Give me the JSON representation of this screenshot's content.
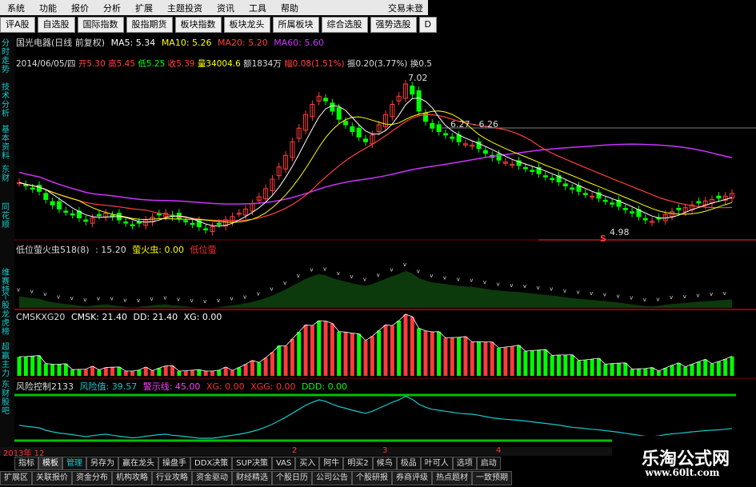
{
  "menu": {
    "items": [
      "系统",
      "功能",
      "报价",
      "分析",
      "扩展",
      "主题投资",
      "资讯",
      "工具",
      "帮助"
    ],
    "account": "交易未登"
  },
  "toolbar": [
    "评A股",
    "自选股",
    "国际指数",
    "股指期货",
    "板块指数",
    "板块龙头",
    "所属板块",
    "综合选股",
    "强势选股",
    "D"
  ],
  "leftnav": [
    "分时走势",
    "技术分析",
    "基本资料",
    "东财",
    "同花顺"
  ],
  "leftnav2": [
    "维赛特",
    "个股龙虎榜",
    "超赢主力",
    "东财股吧"
  ],
  "main": {
    "title_name": "国光电器(日线 前复权)",
    "ma5": "MA5: 5.34",
    "ma10": "MA10: 5.26",
    "ma20": "MA20: 5.20",
    "ma60": "MA60: 5.60",
    "date": "2014/06/05/四",
    "open": "开5.30",
    "high": "高5.45",
    "low": "低5.25",
    "close": "收5.39",
    "vol": "量34004.6",
    "amount": "额1834万",
    "change": "幅0.08(1.51%)",
    "amp": "振0.20(3.77%)",
    "turn": "换0.5",
    "ann_high": "7.02",
    "ann_mid": "6.27 - 6.26",
    "ann_low": "4.98",
    "ann_s": "S"
  },
  "ind1": {
    "name": "低位萤火虫518(8)",
    "v1": ": 15.20",
    "v2": "萤火虫: 0.00",
    "v3": "低位萤"
  },
  "ind2": {
    "name": "CMSKXG20",
    "cmsk": "CMSK: 21.40",
    "dd": "DD: 21.40",
    "xg": "XG: 0.00"
  },
  "ind3": {
    "name": "风险控制2133",
    "risk": "风险值: 39.57",
    "warn": "警示线: 45.00",
    "xg": "XG: 0.00",
    "xgg": "XGG: 0.00",
    "ddd": "DDD: 0.00"
  },
  "datebar": {
    "year": "2013年 12",
    "m2": "2",
    "m3": "3",
    "m4": "4"
  },
  "tabs1": [
    "指标",
    "模板",
    "管理",
    "另存为",
    "赢在龙头",
    "操盘手",
    "DDX决策",
    "SUP决策",
    "VAS",
    "买入",
    "阿牛",
    "明买2",
    "候鸟",
    "极品",
    "叶可人",
    "选项",
    "启动"
  ],
  "tabs2": [
    "扩展区",
    "关联报价",
    "资金分布",
    "机构攻略",
    "行业攻略",
    "资金驱动",
    "财经精选",
    "个股日历",
    "公司公告",
    "个股研报",
    "券商评级",
    "热点题材",
    "一致预期"
  ],
  "watermark": {
    "cn": "乐淘公式网",
    "url": "www.60lt.com"
  },
  "colors": {
    "up": "#ff3b3b",
    "down": "#00ff00",
    "ma5": "#ffffff",
    "ma10": "#ffff00",
    "ma20": "#ff4040",
    "ma60": "#cc33ff",
    "cyan": "#19c8c8"
  },
  "chart_data": {
    "type": "candlestick",
    "closes": [
      5.55,
      5.5,
      5.46,
      5.42,
      5.3,
      5.22,
      5.16,
      5.12,
      5.08,
      5.03,
      4.98,
      5.03,
      5.07,
      5.1,
      5.05,
      5.0,
      4.96,
      4.92,
      4.95,
      5.0,
      5.04,
      5.08,
      5.1,
      5.05,
      5.02,
      4.98,
      4.94,
      4.9,
      4.86,
      4.9,
      4.94,
      5.0,
      5.05,
      5.1,
      5.16,
      5.24,
      5.34,
      5.46,
      5.6,
      5.78,
      5.95,
      6.15,
      6.35,
      6.55,
      6.7,
      6.82,
      6.75,
      6.6,
      6.48,
      6.4,
      6.3,
      6.22,
      6.15,
      6.25,
      6.4,
      6.55,
      6.7,
      6.82,
      7.0,
      6.85,
      6.6,
      6.45,
      6.35,
      6.3,
      6.25,
      6.2,
      6.15,
      6.12,
      6.1,
      6.05,
      5.98,
      5.92,
      5.88,
      5.85,
      5.82,
      5.8,
      5.76,
      5.72,
      5.68,
      5.64,
      5.6,
      5.56,
      5.5,
      5.45,
      5.42,
      5.38,
      5.35,
      5.32,
      5.28,
      5.24,
      5.2,
      5.15,
      5.1,
      5.05,
      5.0,
      4.98,
      5.02,
      5.08,
      5.12,
      5.15,
      5.18,
      5.22,
      5.25,
      5.28,
      5.3,
      5.32,
      5.35,
      5.39
    ]
  }
}
